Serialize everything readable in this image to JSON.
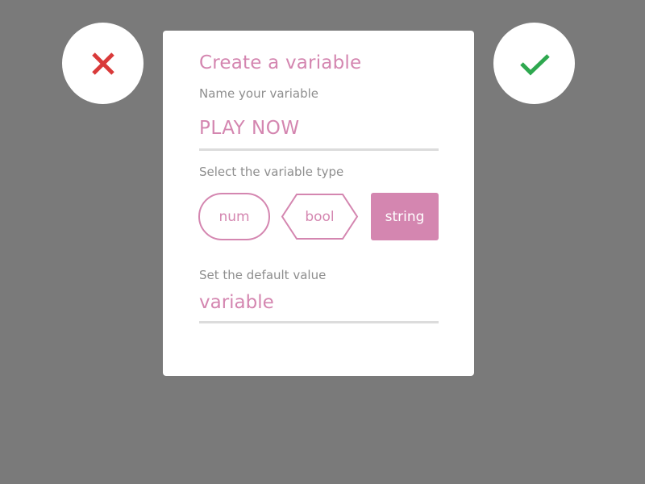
{
  "dialog": {
    "title": "Create a variable",
    "name_label": "Name your variable",
    "name_value": "PLAY NOW",
    "type_label": "Select the variable type",
    "types": [
      {
        "label": "num",
        "selected": false
      },
      {
        "label": "bool",
        "selected": false
      },
      {
        "label": "string",
        "selected": true
      }
    ],
    "default_label": "Set the default value",
    "default_value": "variable"
  },
  "actions": {
    "cancel_icon": "close-icon",
    "confirm_icon": "check-icon"
  },
  "colors": {
    "accent": "#d486b0",
    "backdrop": "#7a7a7a",
    "cancel": "#d93a3a",
    "confirm": "#2ea84f",
    "label": "#8e8e8e",
    "underline": "#dcdcdc"
  }
}
